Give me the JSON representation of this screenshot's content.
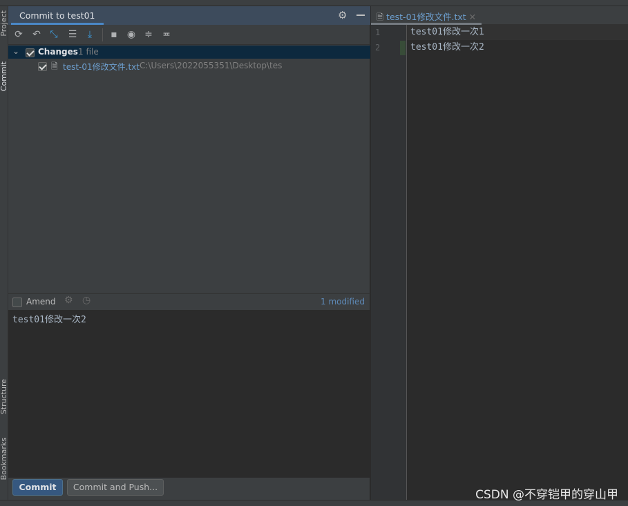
{
  "left_strip": {
    "project": "Project",
    "commit": "Commit",
    "structure": "Structure",
    "bookmarks": "Bookmarks"
  },
  "panel": {
    "tab": "Commit to test01",
    "toolbar_icons": [
      "refresh-icon",
      "rollback-icon",
      "diff-icon",
      "shelve-icon",
      "update-icon",
      "group-by-icon",
      "view-options-icon",
      "expand-all-icon",
      "collapse-all-icon"
    ],
    "changes": {
      "label": "Changes",
      "count": "1 file",
      "checked": true
    },
    "files": [
      {
        "name": "test-01修改文件.txt",
        "path": "C:\\Users\\2022055351\\Desktop\\tes",
        "checked": true
      }
    ],
    "amend_label": "Amend",
    "amend_checked": false,
    "modified": "1 modified",
    "message": "test01修改一次2",
    "commit_button": "Commit",
    "commit_push_button": "Commit and Push..."
  },
  "editor": {
    "tab": "test-01修改文件.txt",
    "lines": [
      {
        "no": "1",
        "text": "test01修改一次1"
      },
      {
        "no": "2",
        "text": "test01修改一次2"
      }
    ]
  },
  "colors": {
    "accent": "#4a88c7",
    "selection": "#0d293e",
    "commit_button": "#365880",
    "change_marker": "#384c38"
  },
  "watermark": "CSDN @不穿铠甲的穿山甲"
}
